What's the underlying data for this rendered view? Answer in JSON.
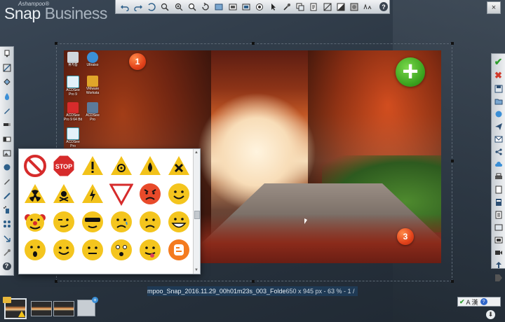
{
  "app": {
    "brand": "Ashampoo®",
    "name": "Snap",
    "edition": "Business"
  },
  "colors": {
    "accent": "#1f3a55",
    "ok": "#2f9e2f",
    "cancel": "#d13a2b",
    "marker": "#e2421a",
    "plus": "#3aa21e"
  },
  "top_toolbar": {
    "icons": [
      "undo-icon",
      "redo-icon",
      "undo-all-icon",
      "zoom-out-icon",
      "zoom-in-icon",
      "zoom-fit-icon",
      "rotate-icon",
      "resize-icon",
      "crop-icon",
      "border-icon",
      "stamp-icon",
      "pointer-icon",
      "color-picker-icon",
      "copy-icon",
      "clipboard-icon",
      "select-icon",
      "fill-icon",
      "blur-icon",
      "text-size-icon"
    ],
    "help": "?"
  },
  "window": {
    "close": "×"
  },
  "left_toolbar": {
    "icons": [
      "marker-icon",
      "rectangle-icon",
      "fill-bucket-icon",
      "drop-icon",
      "pen-icon",
      "highlighter-icon",
      "eraser-icon",
      "image-icon",
      "stamp-icon",
      "pencil-icon",
      "line-icon",
      "spray-icon",
      "dots-icon",
      "arrow-icon",
      "pipette-icon"
    ],
    "help": "?"
  },
  "right_toolbar": {
    "ok": "✔",
    "cancel": "✖",
    "icons": [
      "save-icon",
      "open-icon",
      "pin-icon",
      "send-icon",
      "email-icon",
      "share-icon",
      "cloud-icon",
      "print-icon",
      "document-icon",
      "pdf-icon",
      "export-icon",
      "copy-icon",
      "image-icon",
      "video-icon",
      "upload-icon",
      "tag-icon"
    ]
  },
  "desktop_icons": [
    {
      "label": "휴지통"
    },
    {
      "label": "Ultraiso"
    },
    {
      "label": "ACDSee Pro 9"
    },
    {
      "label": "VMware Worksta"
    },
    {
      "label": "ACDSee Pro 9 64 Bit"
    },
    {
      "label": "ACDSee Pro"
    },
    {
      "label": "ACDSee Pro"
    }
  ],
  "markers": [
    {
      "label": "1"
    },
    {
      "label": "3"
    }
  ],
  "plus_button": "+",
  "stamps": {
    "stop_label": "STOP",
    "items": [
      "no-entry",
      "stop",
      "warning",
      "biohazard",
      "fire",
      "x-sign",
      "radiation",
      "poison",
      "electric",
      "yield",
      "angry-face",
      "smile-face",
      "clown-face",
      "wink-face",
      "cool-face",
      "sad-face",
      "frown-face",
      "grin-face",
      "surprised-face",
      "smile-face-2",
      "neutral-face",
      "shocked-face",
      "tongue-face",
      "blogger-logo"
    ]
  },
  "status_bar": {
    "filename": "mpoo_Snap_2016.11.29_00h01m23s_003_Folde",
    "dims": "650 x 945 px - 63 % - 1 /"
  },
  "tray": {
    "check": "✔",
    "lang": "A 漢",
    "help": "?"
  },
  "scroll_down": "⬇"
}
